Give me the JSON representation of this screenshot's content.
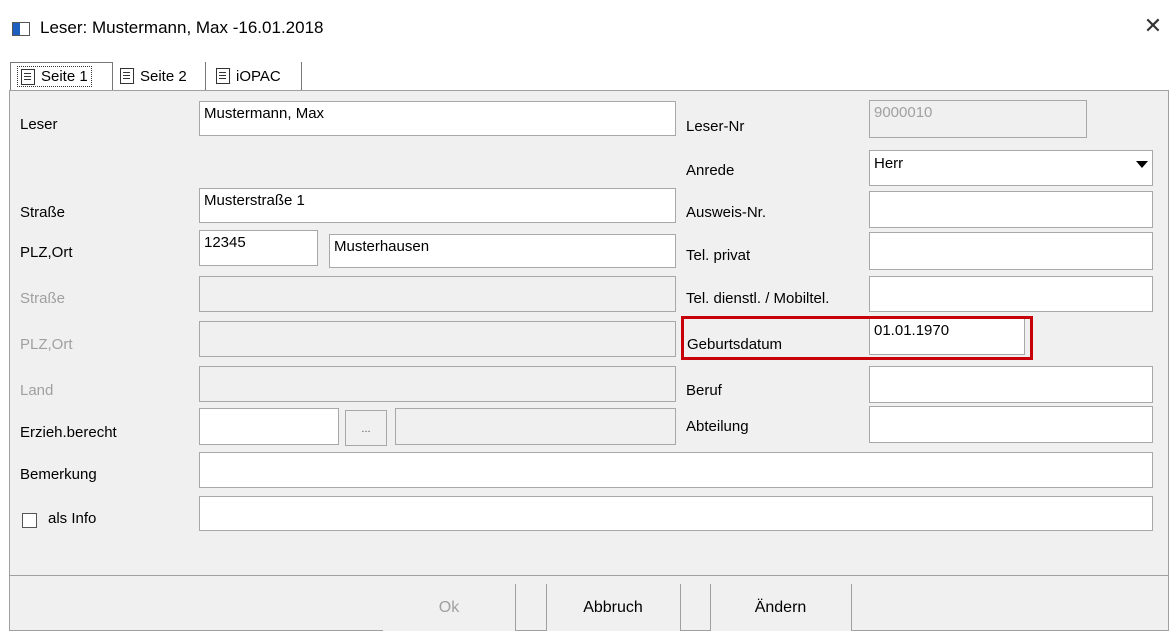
{
  "window": {
    "title": "Leser: Mustermann, Max -16.01.2018",
    "close_glyph": "✕"
  },
  "tabs": [
    {
      "label": "Seite 1"
    },
    {
      "label": "Seite 2"
    },
    {
      "label": "iOPAC"
    }
  ],
  "left": {
    "leser_label": "Leser",
    "leser_value": "Mustermann, Max",
    "strasse_label": "Straße",
    "strasse_value": "Musterstraße 1",
    "plzort_label": "PLZ,Ort",
    "plz_value": "12345",
    "ort_value": "Musterhausen",
    "strasse2_label": "Straße",
    "plzort2_label": "PLZ,Ort",
    "land_label": "Land",
    "erzieh_label": "Erzieh.berecht",
    "ellipsis_label": "...",
    "bemerkung_label": "Bemerkung",
    "info_label": "als Info"
  },
  "right": {
    "lesernr_label": "Leser-Nr",
    "lesernr_value": "9000010",
    "anrede_label": "Anrede",
    "anrede_value": "Herr",
    "ausweis_label": "Ausweis-Nr.",
    "telprivat_label": "Tel. privat",
    "teldienst_label": "Tel. dienstl. / Mobiltel.",
    "geburt_label": "Geburtsdatum",
    "geburt_value": "01.01.1970",
    "beruf_label": "Beruf",
    "abteilung_label": "Abteilung"
  },
  "buttons": {
    "ok": "Ok",
    "abbruch": "Abbruch",
    "aendern": "Ändern"
  },
  "colors": {
    "highlight": "#c8000a",
    "panel": "#f0f0f0"
  }
}
